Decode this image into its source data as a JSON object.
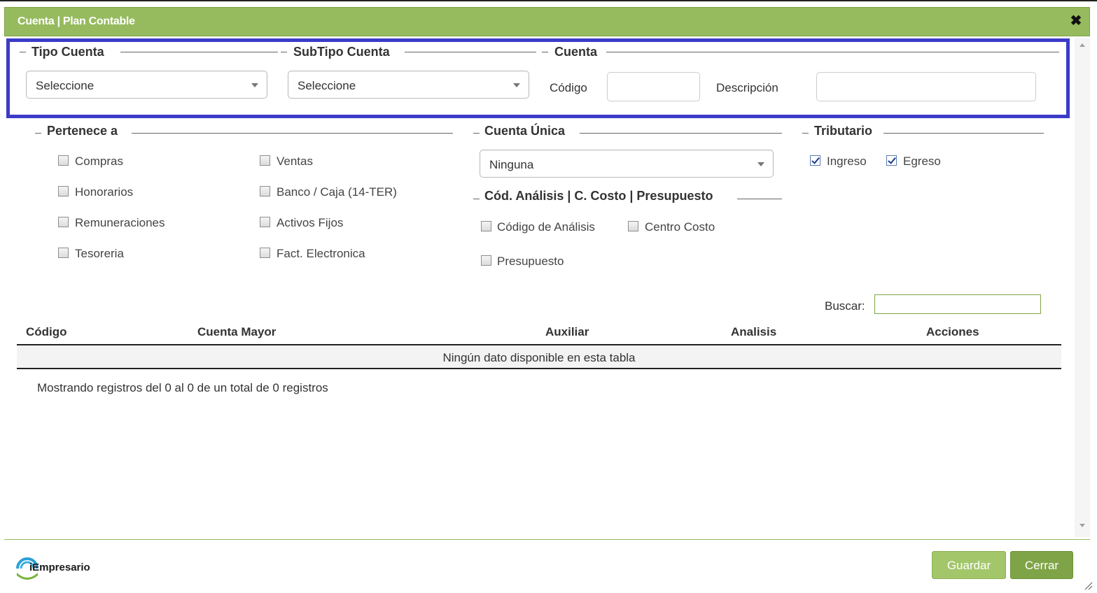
{
  "window": {
    "title": "Cuenta | Plan Contable",
    "close_symbol": "✖"
  },
  "tipo_cuenta": {
    "legend": "Tipo Cuenta",
    "selected": "Seleccione"
  },
  "subtipo_cuenta": {
    "legend": "SubTipo Cuenta",
    "selected": "Seleccione"
  },
  "cuenta": {
    "legend": "Cuenta",
    "codigo_label": "Código",
    "codigo_value": "",
    "descripcion_label": "Descripción",
    "descripcion_value": ""
  },
  "pertenece": {
    "legend": "Pertenece a",
    "items": [
      {
        "label": "Compras",
        "checked": false
      },
      {
        "label": "Ventas",
        "checked": false
      },
      {
        "label": "Honorarios",
        "checked": false
      },
      {
        "label": "Banco / Caja (14-TER)",
        "checked": false
      },
      {
        "label": "Remuneraciones",
        "checked": false
      },
      {
        "label": "Activos Fijos",
        "checked": false
      },
      {
        "label": "Tesoreria",
        "checked": false
      },
      {
        "label": "Fact. Electronica",
        "checked": false
      }
    ]
  },
  "cuenta_unica": {
    "legend": "Cuenta Única",
    "selected": "Ninguna"
  },
  "analisis": {
    "legend": "Cód. Análisis | C. Costo | Presupuesto",
    "items": [
      {
        "label": "Código de Análisis",
        "checked": false
      },
      {
        "label": "Centro Costo",
        "checked": false
      },
      {
        "label": "Presupuesto",
        "checked": false
      }
    ]
  },
  "tributario": {
    "legend": "Tributario",
    "items": [
      {
        "label": "Ingreso",
        "checked": true
      },
      {
        "label": "Egreso",
        "checked": true
      }
    ]
  },
  "table": {
    "search_label": "Buscar:",
    "search_value": "",
    "columns": [
      "Código",
      "Cuenta Mayor",
      "Auxiliar",
      "Analisis",
      "Acciones"
    ],
    "empty_message": "Ningún dato disponible en esta tabla",
    "info": "Mostrando registros del 0 al 0 de un total de 0 registros"
  },
  "footer": {
    "logo_text": "iEmpresario",
    "save_label": "Guardar",
    "close_label": "Cerrar"
  },
  "colors": {
    "accent": "#96bb5e",
    "accent_dark": "#7fa447",
    "highlight": "#3b3bc8"
  }
}
